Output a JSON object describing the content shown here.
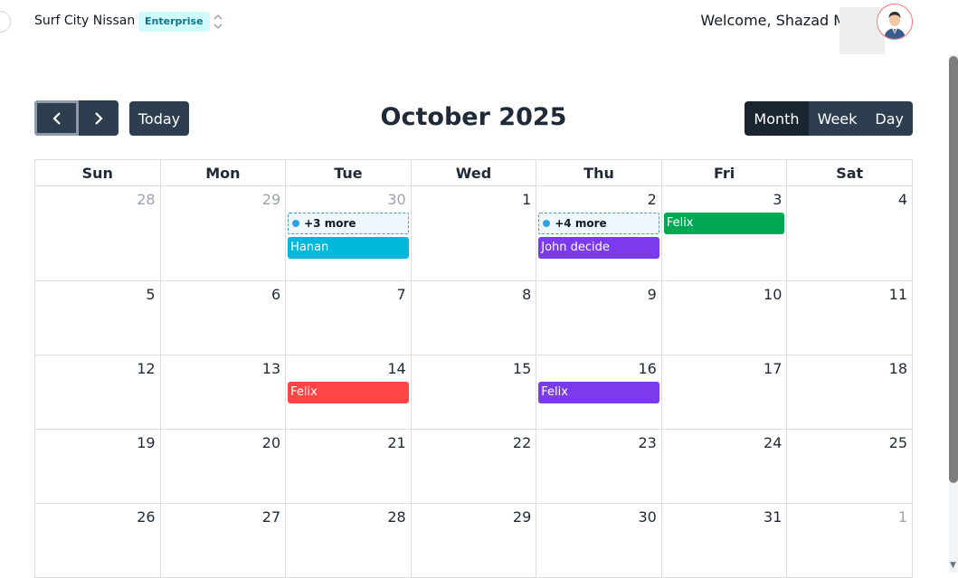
{
  "header": {
    "org_name": "Surf City Nissan",
    "plan_badge": "Enterprise",
    "welcome_text": "Welcome, Shazad Malik"
  },
  "toolbar": {
    "today_label": "Today",
    "title": "October 2025",
    "views": [
      {
        "label": "Month",
        "active": true
      },
      {
        "label": "Week",
        "active": false
      },
      {
        "label": "Day",
        "active": false
      }
    ]
  },
  "calendar": {
    "weekdays": [
      "Sun",
      "Mon",
      "Tue",
      "Wed",
      "Thu",
      "Fri",
      "Sat"
    ],
    "weeks": [
      [
        {
          "day": "28",
          "other": true
        },
        {
          "day": "29",
          "other": true
        },
        {
          "day": "30",
          "other": true,
          "more": "+3 more",
          "events": [
            {
              "title": "Hanan",
              "color": "#00b8d9"
            }
          ]
        },
        {
          "day": "1"
        },
        {
          "day": "2",
          "more": "+4 more",
          "events": [
            {
              "title": "John decide",
              "color": "#7c3aed"
            }
          ]
        },
        {
          "day": "3",
          "events": [
            {
              "title": "Felix",
              "color": "#00a854"
            }
          ]
        },
        {
          "day": "4"
        }
      ],
      [
        {
          "day": "5"
        },
        {
          "day": "6"
        },
        {
          "day": "7"
        },
        {
          "day": "8"
        },
        {
          "day": "9"
        },
        {
          "day": "10"
        },
        {
          "day": "11"
        }
      ],
      [
        {
          "day": "12"
        },
        {
          "day": "13"
        },
        {
          "day": "14",
          "events": [
            {
              "title": "Felix",
              "color": "#ff4545"
            }
          ]
        },
        {
          "day": "15"
        },
        {
          "day": "16",
          "events": [
            {
              "title": "Felix",
              "color": "#7c3aed"
            }
          ]
        },
        {
          "day": "17"
        },
        {
          "day": "18"
        }
      ],
      [
        {
          "day": "19"
        },
        {
          "day": "20"
        },
        {
          "day": "21"
        },
        {
          "day": "22"
        },
        {
          "day": "23"
        },
        {
          "day": "24"
        },
        {
          "day": "25"
        }
      ],
      [
        {
          "day": "26"
        },
        {
          "day": "27"
        },
        {
          "day": "28"
        },
        {
          "day": "29"
        },
        {
          "day": "30"
        },
        {
          "day": "31"
        },
        {
          "day": "1",
          "other": true
        }
      ]
    ]
  }
}
